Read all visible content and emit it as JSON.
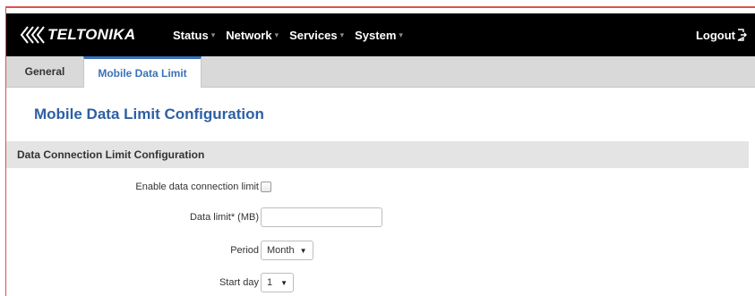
{
  "brand": {
    "name": "TELTONIKA",
    "logo_icon": "teltonika-chevrons-icon"
  },
  "nav": {
    "menu": [
      {
        "label": "Status"
      },
      {
        "label": "Network"
      },
      {
        "label": "Services"
      },
      {
        "label": "System"
      }
    ],
    "logout_label": "Logout",
    "logout_icon": "logout-arrow-icon"
  },
  "tabs": [
    {
      "label": "General",
      "active": false
    },
    {
      "label": "Mobile Data Limit",
      "active": true
    }
  ],
  "page_title": "Mobile Data Limit Configuration",
  "section": {
    "title": "Data Connection Limit Configuration",
    "fields": {
      "enable": {
        "label": "Enable data connection limit",
        "checked": false
      },
      "data_limit": {
        "label": "Data limit* (MB)",
        "value": "",
        "placeholder": ""
      },
      "period": {
        "label": "Period",
        "value": "Month"
      },
      "start_day": {
        "label": "Start day",
        "value": "1"
      }
    }
  },
  "colors": {
    "navbar": "#000000",
    "accent": "#3a72b7",
    "title": "#2e5fa3",
    "frame": "#d9534f"
  }
}
